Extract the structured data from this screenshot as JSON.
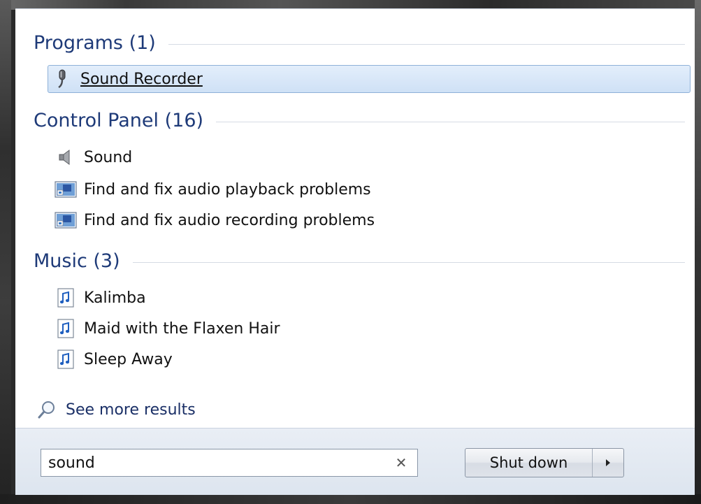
{
  "groups": {
    "programs": {
      "title": "Programs (1)"
    },
    "control_panel": {
      "title": "Control Panel (16)"
    },
    "music": {
      "title": "Music (3)"
    }
  },
  "programs": [
    {
      "label": "Sound Recorder",
      "icon": "microphone-icon",
      "selected": true
    }
  ],
  "control_panel": [
    {
      "label": "Sound",
      "icon": "speaker-icon"
    },
    {
      "label": "Find and fix audio playback problems",
      "icon": "troubleshoot-icon"
    },
    {
      "label": "Find and fix audio recording problems",
      "icon": "troubleshoot-icon"
    }
  ],
  "music": [
    {
      "label": "Kalimba",
      "icon": "music-file-icon"
    },
    {
      "label": "Maid with the Flaxen Hair",
      "icon": "music-file-icon"
    },
    {
      "label": "Sleep Away",
      "icon": "music-file-icon"
    }
  ],
  "see_more": {
    "label": "See more results",
    "icon": "magnifier-icon"
  },
  "search": {
    "value": "sound",
    "clear_icon": "clear-icon"
  },
  "shutdown": {
    "label": "Shut down",
    "arrow_icon": "chevron-right-icon"
  },
  "colors": {
    "group_title": "#1e3a78",
    "selection_fill": "#cfe1f6",
    "selection_border": "#8eb1d8",
    "footer_bg": "#e3e9f2"
  }
}
